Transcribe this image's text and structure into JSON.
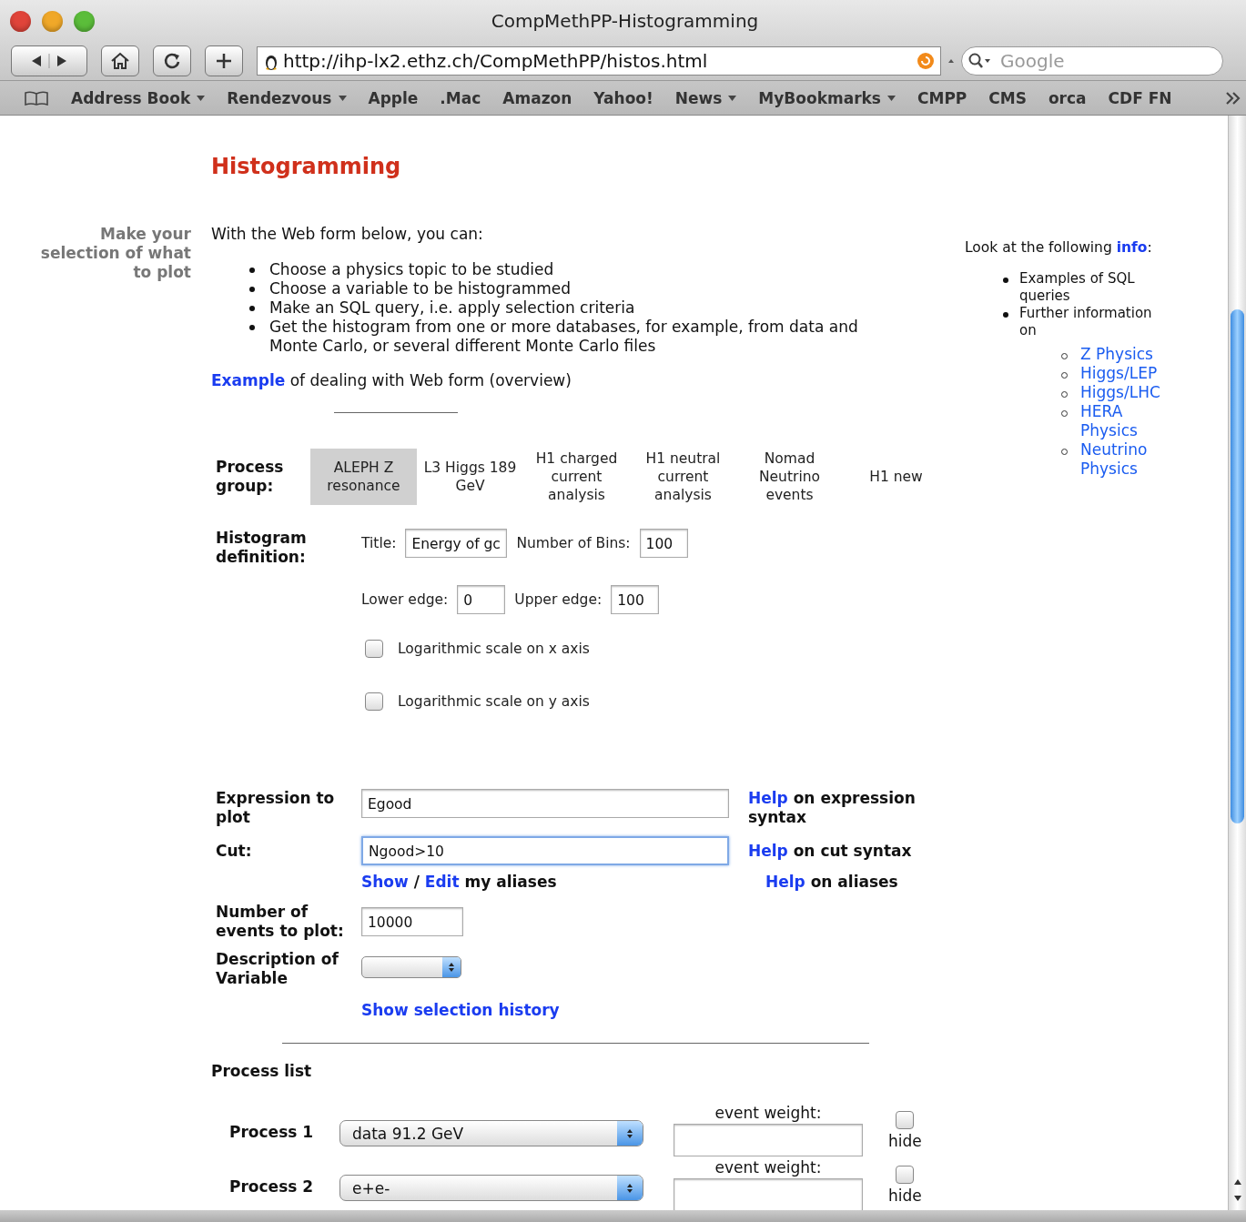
{
  "window": {
    "title": "CompMethPP-Histogramming"
  },
  "toolbar": {
    "url": "http://ihp-lx2.ethz.ch/CompMethPP/histos.html",
    "search": {
      "placeholder": "Google"
    }
  },
  "bookmarks": [
    {
      "label": "Address Book",
      "menu": true
    },
    {
      "label": "Rendezvous",
      "menu": true
    },
    {
      "label": "Apple",
      "menu": false
    },
    {
      "label": ".Mac",
      "menu": false
    },
    {
      "label": "Amazon",
      "menu": false
    },
    {
      "label": "Yahoo!",
      "menu": false
    },
    {
      "label": "News",
      "menu": true
    },
    {
      "label": "MyBookmarks",
      "menu": true
    },
    {
      "label": "CMPP",
      "menu": false
    },
    {
      "label": "CMS",
      "menu": false
    },
    {
      "label": "orca",
      "menu": false
    },
    {
      "label": "CDF FN",
      "menu": false
    }
  ],
  "page": {
    "heading": "Histogramming",
    "side_label": "Make your selection of what to plot",
    "intro": "With the Web form below, you can:",
    "bullets": [
      "Choose a physics topic to be studied",
      "Choose a variable to be histogrammed",
      "Make an SQL query, i.e. apply selection criteria",
      "Get the histogram from one or more databases, for example, from data and Monte Carlo, or several different Monte Carlo files"
    ],
    "example": {
      "link": "Example",
      "text": "of dealing with Web form (overview)"
    },
    "info": {
      "lead": "Look at the following",
      "link": "info",
      "after": ":",
      "items": [
        {
          "text": "Examples of SQL queries"
        },
        {
          "text": "Further information on",
          "children": [
            {
              "text": "Z Physics"
            },
            {
              "text": "Higgs/LEP"
            },
            {
              "text": "Higgs/LHC"
            },
            {
              "text": "HERA Physics"
            },
            {
              "text": "Neutrino Physics"
            }
          ]
        }
      ]
    }
  },
  "form": {
    "process_group": {
      "label": "Process group:",
      "tabs": [
        {
          "label": "ALEPH Z resonance",
          "selected": true
        },
        {
          "label": "L3 Higgs 189 GeV",
          "selected": false
        },
        {
          "label": "H1 charged current analysis",
          "selected": false
        },
        {
          "label": "H1 neutral current analysis",
          "selected": false
        },
        {
          "label": "Nomad Neutrino events",
          "selected": false
        },
        {
          "label": "H1 new",
          "selected": false
        }
      ]
    },
    "histogram": {
      "label": "Histogram definition:",
      "title": {
        "label": "Title:",
        "value": "Energy of gc"
      },
      "bins": {
        "label": "Number of Bins:",
        "value": "100"
      },
      "lower": {
        "label": "Lower edge:",
        "value": "0"
      },
      "upper": {
        "label": "Upper edge:",
        "value": "100"
      },
      "options": [
        {
          "label": "Logarithmic scale on x axis",
          "checked": false
        },
        {
          "label": "Logarithmic scale on y axis",
          "checked": false
        }
      ]
    },
    "expression": {
      "label": "Expression to plot",
      "value": "Egood",
      "help_link": "Help",
      "help_text": "on expression syntax"
    },
    "cut": {
      "label": "Cut:",
      "value": "Ngood>10",
      "focused": true,
      "help_link": "Help",
      "help_text": "on cut syntax"
    },
    "aliases": {
      "show": "Show",
      "sep": "/",
      "edit": "Edit",
      "text": "my aliases",
      "help_link": "Help",
      "help_text": "on aliases"
    },
    "events": {
      "label": "Number of events to plot:",
      "value": "10000"
    },
    "description": {
      "label": "Description of Variable"
    },
    "history_link": "Show selection history"
  },
  "process_list": {
    "heading": "Process list",
    "processes": [
      {
        "label": "Process 1",
        "value": "data 91.2 GeV",
        "weight_label": "event weight:",
        "hide_label": "hide",
        "hidden": false
      },
      {
        "label": "Process 2",
        "value": "e+e-",
        "weight_label": "event weight:",
        "hide_label": "hide",
        "hidden": false
      }
    ]
  }
}
